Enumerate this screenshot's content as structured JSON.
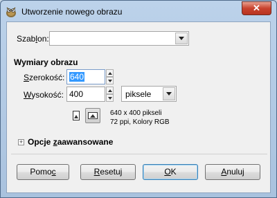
{
  "window": {
    "title": "Utworzenie nowego obrazu",
    "close_label": "✕"
  },
  "template": {
    "label_prefix": "Szab",
    "label_underlined": "l",
    "label_suffix": "on:",
    "value": ""
  },
  "image_size": {
    "section_title": "Wymiary obrazu",
    "width": {
      "label_underlined": "S",
      "label_rest": "zerokość:",
      "value": "640"
    },
    "height": {
      "label_underlined": "W",
      "label_rest": "ysokość:",
      "value": "400"
    },
    "unit": "piksele",
    "info_line1": "640 x 400 pikseli",
    "info_line2": "72 ppi, Kolory RGB"
  },
  "advanced": {
    "label_prefix": "Opcje ",
    "label_underlined": "z",
    "label_suffix": "aawansowane",
    "expander_glyph": "+"
  },
  "buttons": {
    "help": {
      "prefix": "Pomo",
      "underlined": "c",
      "suffix": ""
    },
    "reset": {
      "prefix": "",
      "underlined": "R",
      "suffix": "esetuj"
    },
    "ok": {
      "prefix": "",
      "underlined": "O",
      "suffix": "K"
    },
    "cancel": {
      "prefix": "",
      "underlined": "A",
      "suffix": "nuluj"
    }
  },
  "colors": {
    "selection": "#3399ff",
    "close_button": "#c9432e",
    "default_button_border": "#3c7fb1"
  }
}
